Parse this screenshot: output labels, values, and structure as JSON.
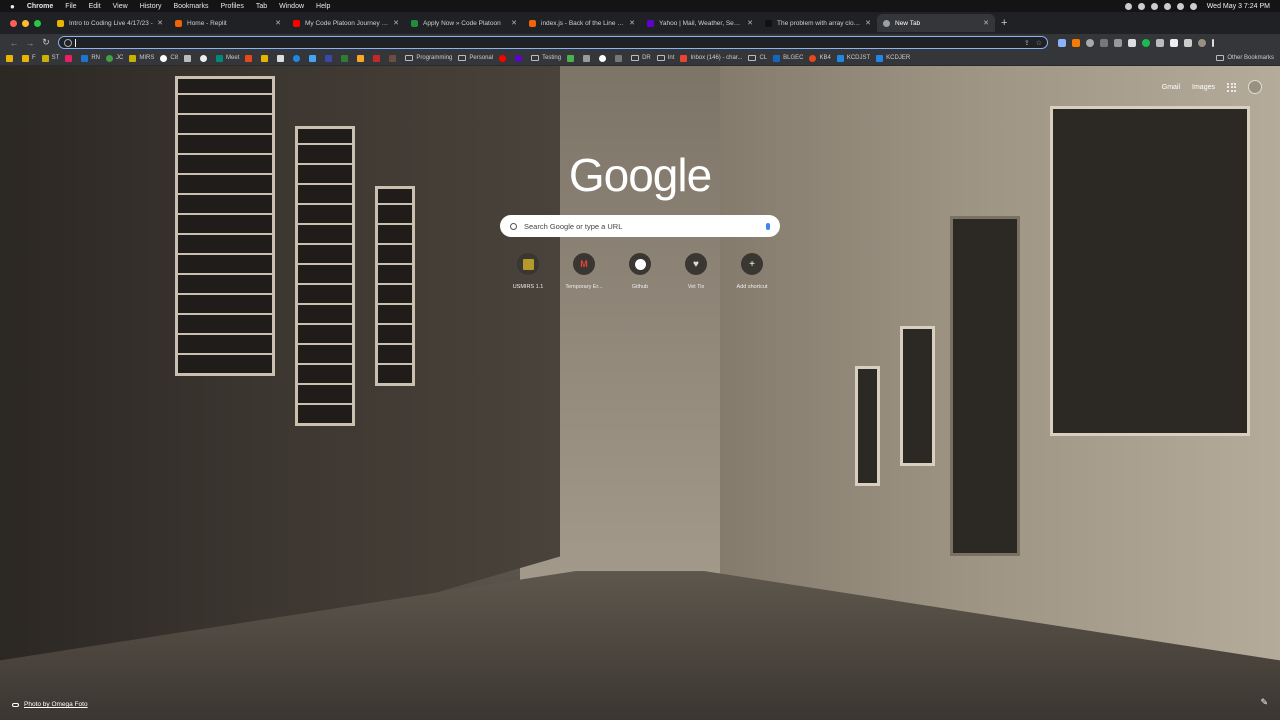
{
  "menubar": {
    "apple": "",
    "app": "Chrome",
    "items": [
      "File",
      "Edit",
      "View",
      "History",
      "Bookmarks",
      "Profiles",
      "Tab",
      "Window",
      "Help"
    ],
    "clock": "Wed May 3  7:24 PM"
  },
  "tabs": [
    {
      "title": "Intro to Coding Live 4/17/23 -",
      "color": "#e8b400"
    },
    {
      "title": "Home - Replit",
      "color": "#f26207"
    },
    {
      "title": "My Code Platoon Journey - Th",
      "color": "#ff0000"
    },
    {
      "title": "Apply Now » Code Platoon",
      "color": "#1e8e3e"
    },
    {
      "title": "index.js - Back of the Line (Ar",
      "color": "#f26207"
    },
    {
      "title": "Yahoo | Mail, Weather, Search",
      "color": "#6001d2"
    },
    {
      "title": "The problem with array cloning",
      "color": "#111111"
    },
    {
      "title": "New Tab",
      "color": "#9aa0a6"
    }
  ],
  "toolbar": {
    "omnibox_value": ""
  },
  "bookmarks": {
    "items": [
      "F",
      "ST",
      "RN",
      "JC",
      "MIRS",
      "C8",
      "Meet",
      "Programming",
      "Personal",
      "Testing",
      "DR",
      "Int",
      "Inbox (146) - char...",
      "CL",
      "BLGEC",
      "KB4",
      "KCDJST",
      "KCDJER"
    ],
    "other": "Other Bookmarks"
  },
  "ntp": {
    "gmail": "Gmail",
    "images": "Images",
    "logo": "Google",
    "search_placeholder": "Search Google or type a URL",
    "shortcuts": [
      {
        "label": "USMIRS 1.1",
        "icon": "usmirs-icon"
      },
      {
        "label": "Temporary Er...",
        "icon": "gmail-icon"
      },
      {
        "label": "Github",
        "icon": "github-icon"
      },
      {
        "label": "Vet Tix",
        "icon": "heart-icon"
      },
      {
        "label": "Add shortcut",
        "icon": "plus-icon"
      }
    ],
    "photo_credit": "Photo by Omega Foto"
  }
}
